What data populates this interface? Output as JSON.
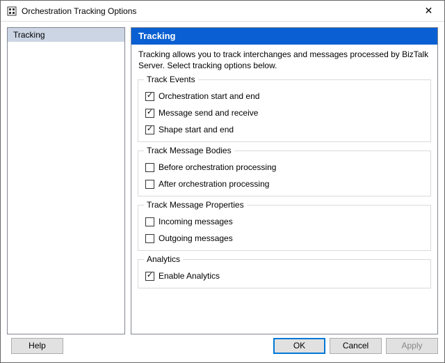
{
  "window": {
    "title": "Orchestration Tracking Options",
    "close_glyph": "✕"
  },
  "nav": {
    "items": [
      {
        "label": "Tracking"
      }
    ]
  },
  "content": {
    "header": "Tracking",
    "description": "Tracking allows you to track interchanges and messages processed by BizTalk Server. Select tracking options below."
  },
  "groups": {
    "events": {
      "legend": "Track Events",
      "items": [
        {
          "label": "Orchestration start and end",
          "checked": true
        },
        {
          "label": "Message send and receive",
          "checked": true
        },
        {
          "label": "Shape start and end",
          "checked": true
        }
      ]
    },
    "bodies": {
      "legend": "Track Message Bodies",
      "items": [
        {
          "label": "Before orchestration processing",
          "checked": false
        },
        {
          "label": "After orchestration processing",
          "checked": false
        }
      ]
    },
    "properties": {
      "legend": "Track Message Properties",
      "items": [
        {
          "label": "Incoming messages",
          "checked": false
        },
        {
          "label": "Outgoing messages",
          "checked": false
        }
      ]
    },
    "analytics": {
      "legend": "Analytics",
      "items": [
        {
          "label": "Enable Analytics",
          "checked": true
        }
      ]
    }
  },
  "buttons": {
    "help": "Help",
    "ok": "OK",
    "cancel": "Cancel",
    "apply": "Apply"
  }
}
